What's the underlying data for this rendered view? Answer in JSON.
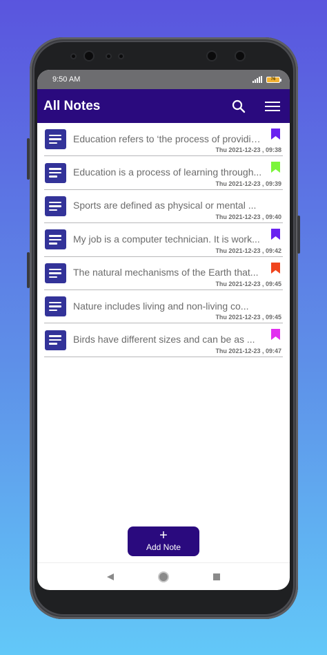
{
  "status_bar": {
    "time": "9:50 AM",
    "battery_level": "76"
  },
  "app_bar": {
    "title": "All Notes",
    "search_icon": "search-icon",
    "menu_icon": "menu-icon"
  },
  "notes": [
    {
      "text": "Education refers to ‘the process of providing...",
      "date": "Thu 2021-12-23 , 09:38",
      "bookmark_color": "#6a22f0"
    },
    {
      "text": "Education is a process of learning through...",
      "date": "Thu 2021-12-23 , 09:39",
      "bookmark_color": "#7bf53b"
    },
    {
      "text": "Sports are defined as physical or mental ...",
      "date": "Thu 2021-12-23 , 09:40",
      "bookmark_color": ""
    },
    {
      "text": "My job is a computer technician. It is work...",
      "date": "Thu 2021-12-23 , 09:42",
      "bookmark_color": "#6a22f0"
    },
    {
      "text": "The natural mechanisms of the Earth that...",
      "date": "Thu 2021-12-23 , 09:45",
      "bookmark_color": "#f0451e"
    },
    {
      "text": "Nature includes living and non-living co...",
      "date": "Thu 2021-12-23 , 09:45",
      "bookmark_color": ""
    },
    {
      "text": "Birds have different sizes and can be as ...",
      "date": "Thu 2021-12-23 , 09:47",
      "bookmark_color": "#e22ef0"
    }
  ],
  "add_button": {
    "plus": "+",
    "label": "Add Note"
  },
  "nav": {
    "back_icon": "back-triangle-icon",
    "home_icon": "home-circle-icon",
    "recents_icon": "recents-square-icon"
  },
  "colors": {
    "app_bar": "#2a0a7e",
    "note_icon": "#333399"
  }
}
